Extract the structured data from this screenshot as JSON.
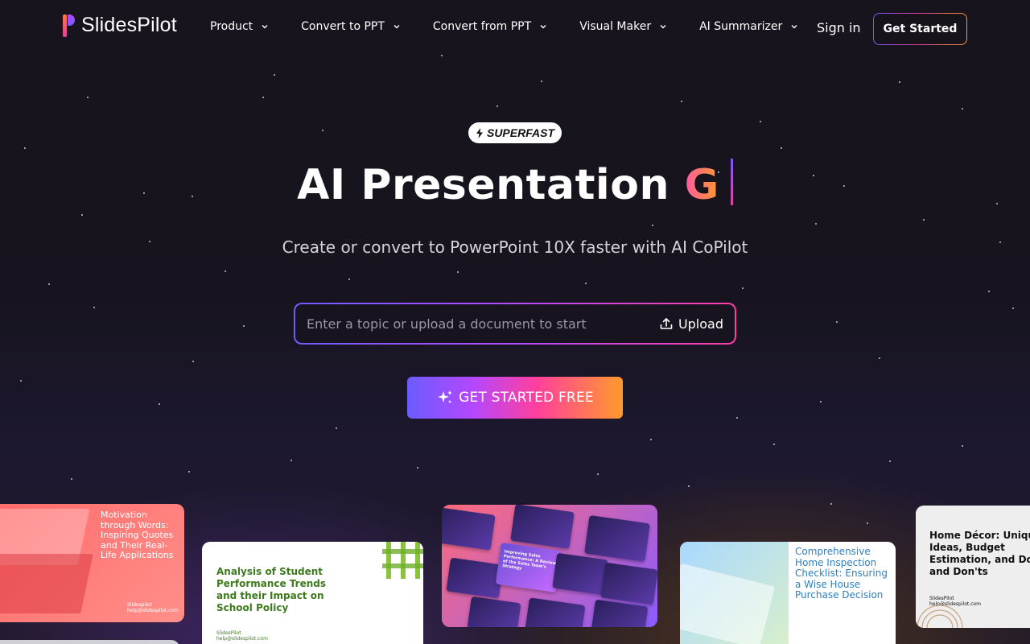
{
  "brand": {
    "name": "SlidesPilot"
  },
  "nav": {
    "items": [
      {
        "label": "Product"
      },
      {
        "label": "Convert to PPT"
      },
      {
        "label": "Convert from PPT"
      },
      {
        "label": "Visual Maker"
      },
      {
        "label": "AI Summarizer"
      }
    ],
    "sign_in": "Sign in",
    "get_started": "Get Started"
  },
  "hero": {
    "badge": "SUPERFAST",
    "title": "AI Presentation",
    "typed": "G",
    "subtitle": "Create or convert to PowerPoint 10X faster with AI CoPilot",
    "search_placeholder": "Enter a topic or upload a document to start",
    "upload_label": "Upload",
    "cta_label": "GET STARTED FREE"
  },
  "cards": [
    {
      "title": "Motivation through Words: Inspiring Quotes and Their Real-Life Applications",
      "footer_name": "Slidespilot",
      "footer_email": "help@slidespilot.com"
    },
    {
      "title": "Analysis of Student Performance Trends and their Impact on School Policy",
      "footer_name": "SlidesPilot",
      "footer_email": "help@slidespilot.com"
    },
    {
      "title": "Improving Sales Performance: A Review of the Sales Team's Strategy"
    },
    {
      "title": "Comprehensive Home Inspection Checklist: Ensuring a Wise House Purchase Decision"
    },
    {
      "title": "Home Décor: Unique Ideas, Budget Estimation, and Do's and Don'ts",
      "footer_name": "SlidesPilot",
      "footer_email": "help@slidespilot.com"
    }
  ],
  "colors": {
    "accent_start": "#6b5cff",
    "accent_mid": "#ff3f9c",
    "accent_end": "#ff9a2b",
    "background": "#17141d"
  }
}
